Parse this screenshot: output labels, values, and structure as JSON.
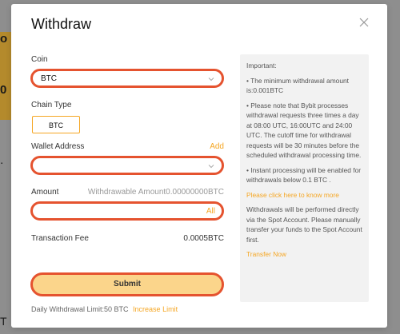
{
  "background": {
    "fragment_left_top": "o",
    "fragment_left_mid": "0",
    "fragment_left_low": "⋅",
    "fragment_left_bottom": "T"
  },
  "modal": {
    "title": "Withdraw",
    "close_icon": "close-icon"
  },
  "form": {
    "coin": {
      "label": "Coin",
      "selected": "BTC"
    },
    "chain": {
      "label": "Chain Type",
      "selected": "BTC"
    },
    "wallet": {
      "label": "Wallet Address",
      "add_label": "Add",
      "value": ""
    },
    "amount": {
      "label": "Amount",
      "withdrawable": "Withdrawable Amount0.00000000BTC",
      "all_label": "All",
      "value": ""
    },
    "fee": {
      "label": "Transaction Fee",
      "value": "0.0005BTC"
    },
    "submit_label": "Submit",
    "daily_limit": "Daily Withdrawal Limit:50 BTC",
    "increase_limit": "Increase Limit"
  },
  "info": {
    "heading": "Important:",
    "bullet1": "• The minimum withdrawal amount is:0.001BTC",
    "bullet2": "• Please note that Bybit processes withdrawal requests three times a day at 08:00 UTC, 16:00UTC and 24:00 UTC. The cutoff time for withdrawal requests will be 30 minutes before the scheduled withdrawal processing time.",
    "bullet3": "• Instant processing will be enabled for withdrawals below 0.1 BTC .",
    "know_more": "Please click here to know more",
    "spot_note": "Withdrawals will be performed directly via the Spot Account. Please manually transfer your funds to the Spot Account first.",
    "transfer_now": "Transfer Now"
  },
  "colors": {
    "accent": "#f5a623",
    "highlight": "#e5532f",
    "submit_bg": "#fbd58b",
    "backdrop": "#8e8e8e"
  }
}
